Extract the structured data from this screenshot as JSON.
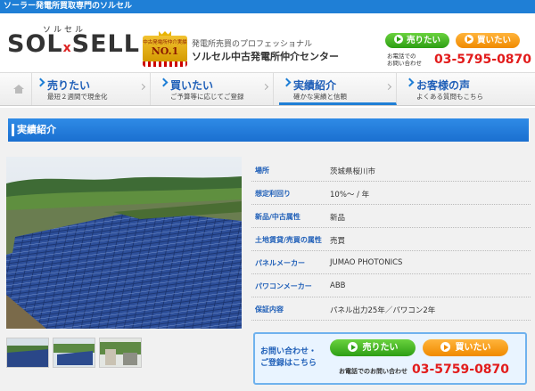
{
  "topbar": {
    "text": "ソーラー発電所買取専門のソルセル"
  },
  "header": {
    "logo_kana": "ソルセル",
    "logo_left": "SOL",
    "logo_x": "x",
    "logo_right": "SELL",
    "award_small": "中古発電所仲介実績",
    "award_main": "NO.1",
    "tagline": "発電所売買のプロフェッショナル",
    "center_name": "ソルセル中古発電所仲介センター",
    "sell_label": "売りたい",
    "buy_label": "買いたい",
    "phone_label_1": "お電話での",
    "phone_label_2": "お問い合わせ",
    "phone": "03-5795-0870"
  },
  "nav": {
    "items": [
      {
        "title": "売りたい",
        "sub": "最短２週間で現金化"
      },
      {
        "title": "買いたい",
        "sub": "ご予算等に応じてご登録"
      },
      {
        "title": "実績紹介",
        "sub": "確かな実績と信頼"
      },
      {
        "title": "お客様の声",
        "sub": "よくある質問もこちら"
      }
    ]
  },
  "section": {
    "title": "実績紹介"
  },
  "spec": {
    "rows": [
      {
        "key": "場所",
        "value": "茨城県桜川市"
      },
      {
        "key": "想定利回り",
        "value": "10%〜 / 年"
      },
      {
        "key": "新品/中古属性",
        "value": "新品"
      },
      {
        "key": "土地賃貸/売買の属性",
        "value": "売買"
      },
      {
        "key": "パネルメーカー",
        "value": "JUMAO PHOTONICS"
      },
      {
        "key": "パワコンメーカー",
        "value": "ABB"
      },
      {
        "key": "保証内容",
        "value": "パネル出力25年／パワコン2年"
      }
    ]
  },
  "cta": {
    "text_1": "お問い合わせ・",
    "text_2": "ご登録はこちら",
    "sell_label": "売りたい",
    "buy_label": "買いたい",
    "phone_label": "お電話でのお問い合わせ",
    "phone": "03-5759-0870"
  },
  "icons": {
    "home": "home-icon",
    "arrow": "arrow-right-icon",
    "chevron": "chevron-right-icon"
  },
  "colors": {
    "brand_blue": "#1f7fd6",
    "green_button": "#2d9e14",
    "orange_button": "#f08a00",
    "phone_red": "#e21c1c"
  }
}
